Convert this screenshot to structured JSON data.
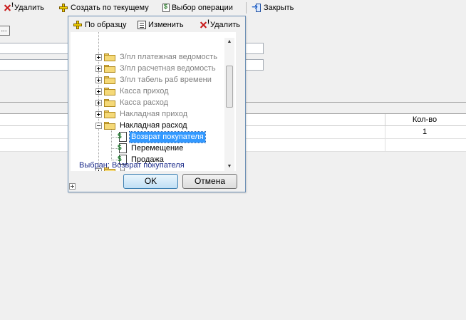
{
  "toolbar": {
    "delete_label": "Удалить",
    "create_label": "Создать по текущему",
    "choose_op_label": "Выбор операции",
    "close_label": "Закрыть"
  },
  "form": {
    "dots_label": "..."
  },
  "grid": {
    "qty_header": "Кол-во",
    "rows": [
      {
        "qty": "1"
      },
      {
        "qty": ""
      }
    ]
  },
  "popup": {
    "by_sample_label": "По образцу",
    "edit_label": "Изменить",
    "delete_label": "Удалить",
    "tree": [
      {
        "label": "З/пл платежная ведомость",
        "kind": "folder",
        "state": "collapsed",
        "muted": true
      },
      {
        "label": "З/пл расчетная ведомость",
        "kind": "folder",
        "state": "collapsed",
        "muted": true
      },
      {
        "label": "З/пл табель раб времени",
        "kind": "folder",
        "state": "collapsed",
        "muted": true
      },
      {
        "label": "Касса приход",
        "kind": "folder",
        "state": "collapsed",
        "muted": true
      },
      {
        "label": "Касса расход",
        "kind": "folder",
        "state": "collapsed",
        "muted": true
      },
      {
        "label": "Накладная приход",
        "kind": "folder",
        "state": "collapsed",
        "muted": true
      },
      {
        "label": "Накладная расход",
        "kind": "folder",
        "state": "expanded",
        "muted": false
      },
      {
        "label": "Возврат покупателя",
        "kind": "doc",
        "selected": true
      },
      {
        "label": "Перемещение",
        "kind": "doc"
      },
      {
        "label": "Продажа",
        "kind": "doc"
      },
      {
        "label": "Н",
        "kind": "folder",
        "state": "collapsed",
        "muted": true
      }
    ],
    "chosen_prefix": "Выбран:",
    "chosen_value": "Возврат покупателя",
    "ok_label": "OK",
    "cancel_label": "Отмена"
  },
  "colors": {
    "selection": "#3399ff",
    "chosen_text": "#1a2a8a",
    "muted_text": "#808080"
  }
}
